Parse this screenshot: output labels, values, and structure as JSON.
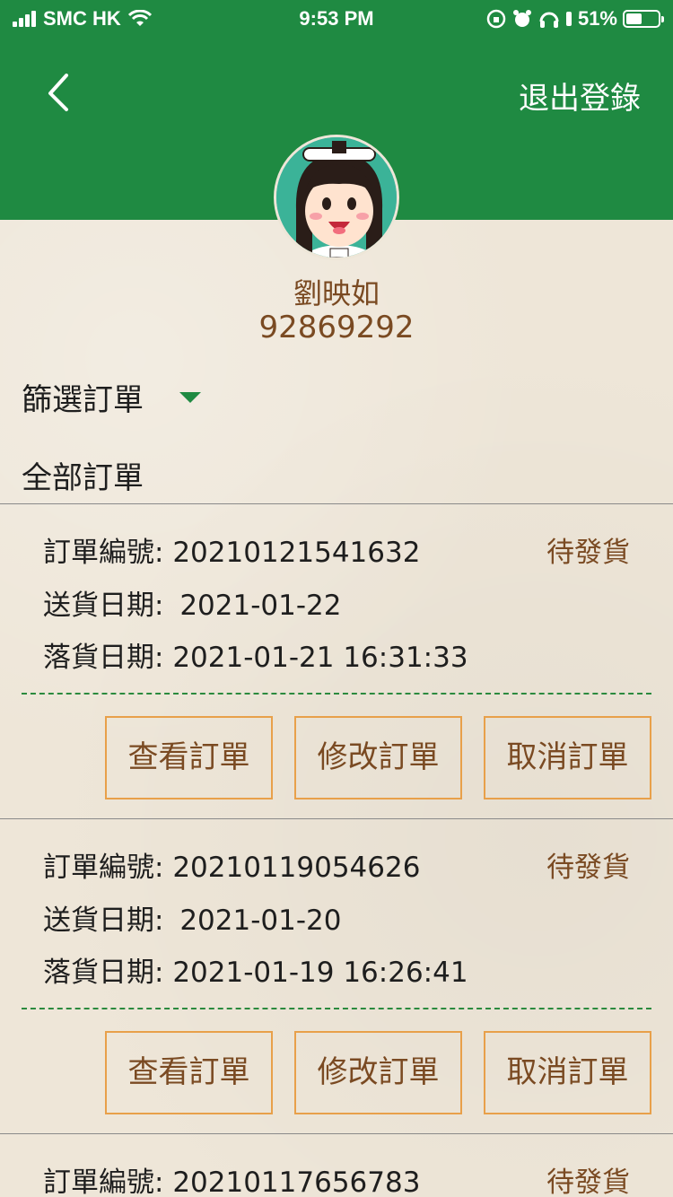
{
  "status_bar": {
    "carrier": "SMC HK",
    "time": "9:53 PM",
    "battery": "51%",
    "battery_level": 0.51
  },
  "header": {
    "logout_label": "退出登錄",
    "back_icon": "chevron-left-icon"
  },
  "user": {
    "name": "劉映如",
    "phone": "92869292"
  },
  "filter": {
    "label": "篩選訂單",
    "selected": "全部訂單"
  },
  "orders": [
    {
      "number_label": "訂單編號:",
      "number": "20210121541632",
      "delivery_label": "送貨日期:",
      "delivery_date": "2021-01-22",
      "placed_label": "落貨日期:",
      "placed_date": "2021-01-21 16:31:33",
      "status": "待發貨",
      "buttons": {
        "view": "查看訂單",
        "edit": "修改訂單",
        "cancel": "取消訂單"
      }
    },
    {
      "number_label": "訂單編號:",
      "number": "20210119054626",
      "delivery_label": "送貨日期:",
      "delivery_date": "2021-01-20",
      "placed_label": "落貨日期:",
      "placed_date": "2021-01-19 16:26:41",
      "status": "待發貨",
      "buttons": {
        "view": "查看訂單",
        "edit": "修改訂單",
        "cancel": "取消訂單"
      }
    },
    {
      "number_label": "訂單編號:",
      "number": "20210117656783",
      "status": "待發貨"
    }
  ],
  "colors": {
    "header_green": "#1f8a42",
    "accent_brown": "#7a4a22",
    "button_border": "#e8a04a",
    "background": "#eee6d8"
  }
}
